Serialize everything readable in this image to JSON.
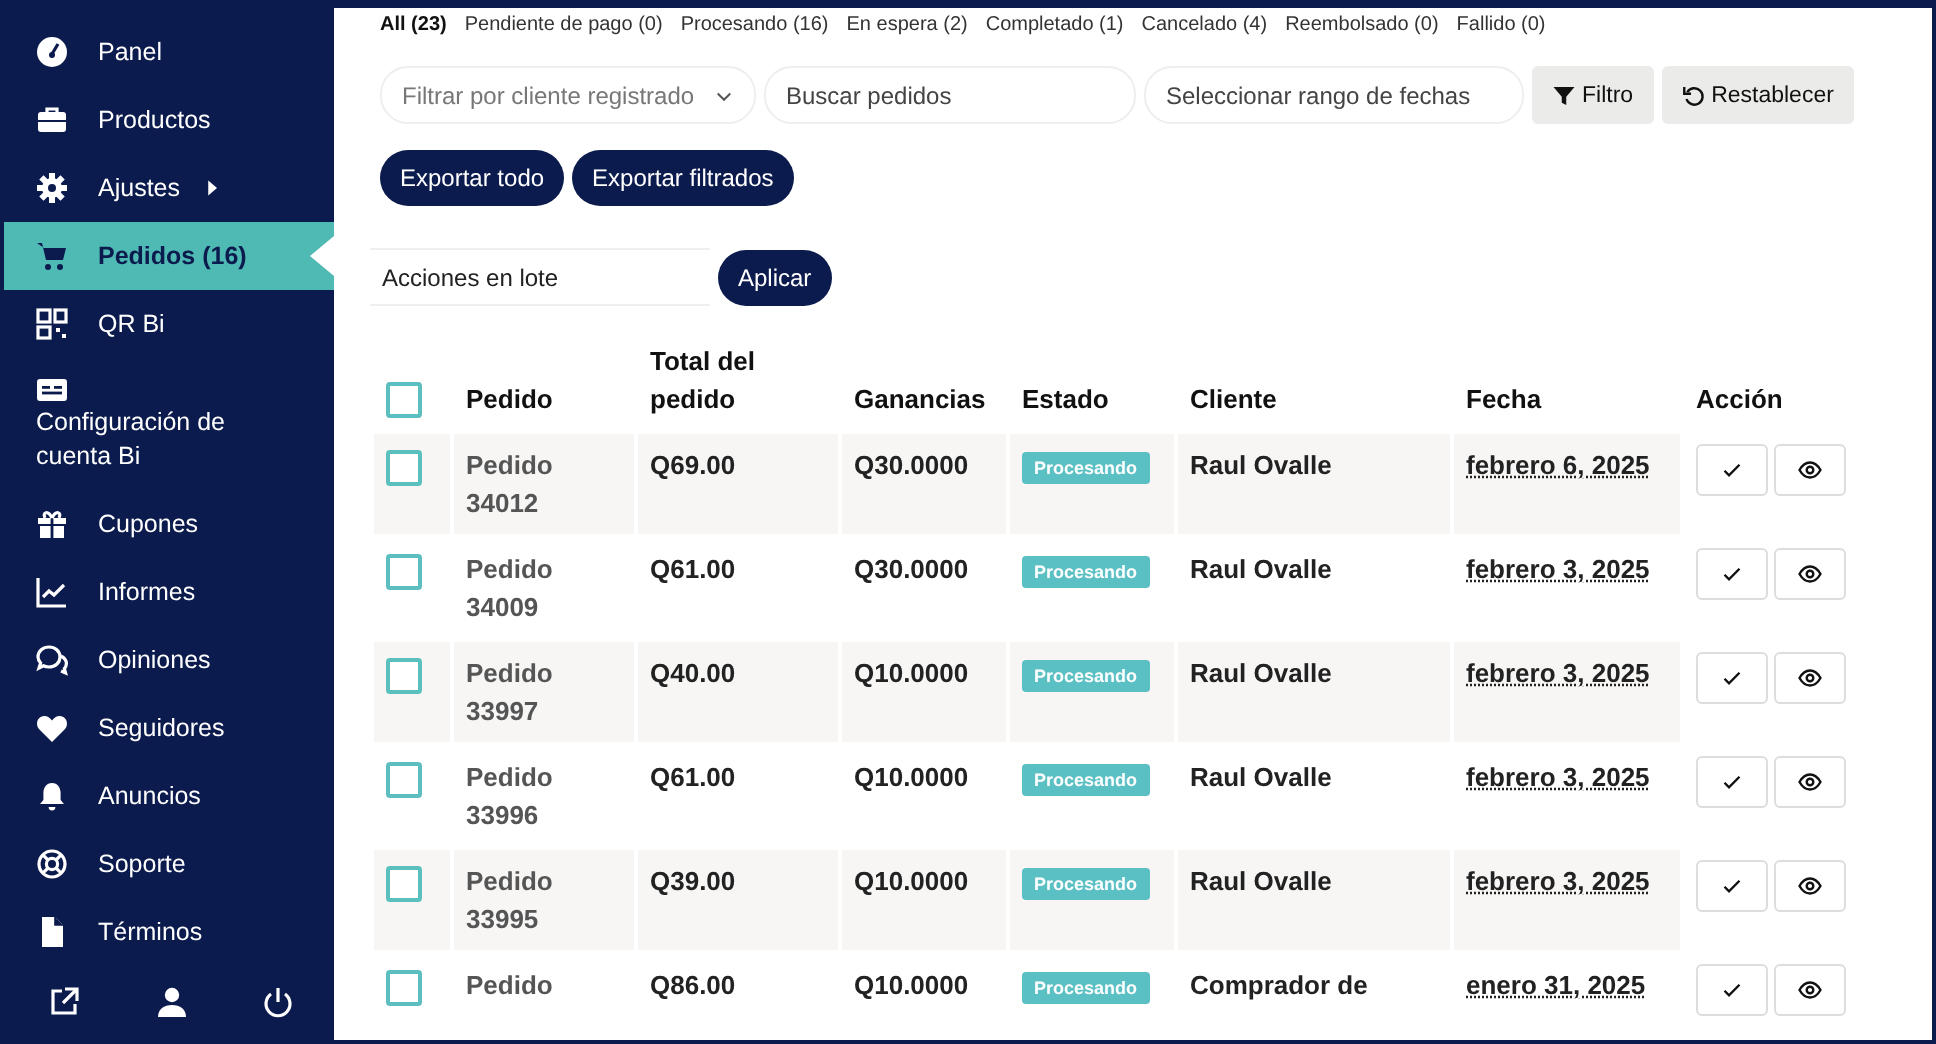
{
  "sidebar": {
    "items": [
      {
        "label": "Panel",
        "selected": false,
        "submenu": false
      },
      {
        "label": "Productos",
        "selected": false,
        "submenu": false
      },
      {
        "label": "Ajustes",
        "selected": false,
        "submenu": true
      },
      {
        "label": "Pedidos (16)",
        "selected": true,
        "submenu": false
      },
      {
        "label": "QR Bi",
        "selected": false,
        "submenu": false
      },
      {
        "label": "Configuración de cuenta Bi",
        "selected": false,
        "submenu": false
      },
      {
        "label": "Cupones",
        "selected": false,
        "submenu": false
      },
      {
        "label": "Informes",
        "selected": false,
        "submenu": false
      },
      {
        "label": "Opiniones",
        "selected": false,
        "submenu": false
      },
      {
        "label": "Seguidores",
        "selected": false,
        "submenu": false
      },
      {
        "label": "Anuncios",
        "selected": false,
        "submenu": false
      },
      {
        "label": "Soporte",
        "selected": false,
        "submenu": false
      },
      {
        "label": "Términos",
        "selected": false,
        "submenu": false
      }
    ]
  },
  "status_tabs": [
    {
      "label": "All (23)",
      "selected": true
    },
    {
      "label": "Pendiente de pago (0)",
      "selected": false
    },
    {
      "label": "Procesando (16)",
      "selected": false
    },
    {
      "label": "En espera (2)",
      "selected": false
    },
    {
      "label": "Completado (1)",
      "selected": false
    },
    {
      "label": "Cancelado (4)",
      "selected": false
    },
    {
      "label": "Reembolsado (0)",
      "selected": false
    },
    {
      "label": "Fallido (0)",
      "selected": false
    }
  ],
  "filters": {
    "customer_filter": {
      "placeholder": "Filtrar por cliente registrado"
    },
    "search": {
      "placeholder": "Buscar pedidos"
    },
    "date_range": {
      "placeholder": "Seleccionar rango de fechas"
    },
    "filter_button": "Filtro",
    "reset_button": "Restablecer"
  },
  "export_buttons": [
    "Exportar todo",
    "Exportar filtrados"
  ],
  "bulk_actions": {
    "value": "Acciones en lote",
    "apply_button": "Aplicar"
  },
  "table": {
    "select_all_checked": false,
    "columns": [
      "Pedido",
      "Total del pedido",
      "Ganancias",
      "Estado",
      "Cliente",
      "Fecha",
      "Acción"
    ],
    "rows": [
      {
        "checked": false,
        "order": "Pedido 34012",
        "total": "Q69.00",
        "earnings": "Q30.0000",
        "status": "Procesando",
        "customer": "Raul Ovalle",
        "date": "febrero 6, 2025"
      },
      {
        "checked": false,
        "order": "Pedido 34009",
        "total": "Q61.00",
        "earnings": "Q30.0000",
        "status": "Procesando",
        "customer": "Raul Ovalle",
        "date": "febrero 3, 2025"
      },
      {
        "checked": false,
        "order": "Pedido 33997",
        "total": "Q40.00",
        "earnings": "Q10.0000",
        "status": "Procesando",
        "customer": "Raul Ovalle",
        "date": "febrero 3, 2025"
      },
      {
        "checked": false,
        "order": "Pedido 33996",
        "total": "Q61.00",
        "earnings": "Q10.0000",
        "status": "Procesando",
        "customer": "Raul Ovalle",
        "date": "febrero 3, 2025"
      },
      {
        "checked": false,
        "order": "Pedido 33995",
        "total": "Q39.00",
        "earnings": "Q10.0000",
        "status": "Procesando",
        "customer": "Raul Ovalle",
        "date": "febrero 3, 2025"
      },
      {
        "checked": false,
        "order": "Pedido",
        "total": "Q86.00",
        "earnings": "Q10.0000",
        "status": "Procesando",
        "customer": "Comprador de",
        "date": "enero 31, 2025"
      }
    ]
  }
}
